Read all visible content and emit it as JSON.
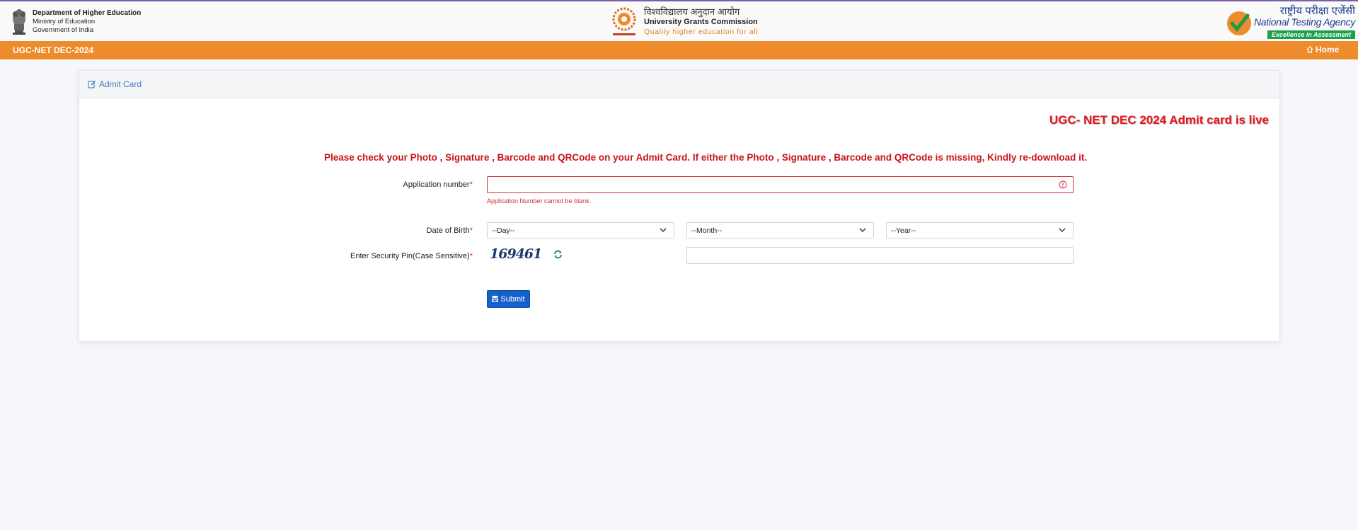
{
  "header": {
    "doe": {
      "line1": "Department of Higher Education",
      "line2": "Ministry of Education",
      "line3": "Government of India",
      "emblem_icon": "national-emblem-icon"
    },
    "ugc": {
      "hindi": "विश्वविद्यालय अनुदान आयोग",
      "english": "University Grants Commission",
      "tagline": "Quality higher education for all",
      "logo_icon": "ugc-logo-icon"
    },
    "nta": {
      "hindi": "राष्ट्रीय परीक्षा एजेंसी",
      "english": "National Testing Agency",
      "tagline": "Excellence in Assessment",
      "logo_icon": "nta-check-icon"
    }
  },
  "navbar": {
    "title": "UGC-NET DEC-2024",
    "home_label": "Home",
    "home_icon": "home-icon",
    "color": "#ee8b2d"
  },
  "card": {
    "title": "Admit Card",
    "title_icon": "edit-icon",
    "live_banner": "UGC- NET DEC 2024 Admit card is live",
    "notice": "Please check your Photo , Signature , Barcode and QRCode on your Admit Card. If either the Photo , Signature , Barcode and QRCode is missing, Kindly re-download it."
  },
  "form": {
    "application_number": {
      "label": "Application number",
      "required_mark": "*",
      "value": "",
      "error": "Application Number cannot be blank."
    },
    "dob": {
      "label": "Date of Birth",
      "required_mark": "*",
      "day_selected": "--Day--",
      "month_selected": "--Month--",
      "year_selected": "--Year--"
    },
    "security_pin": {
      "label": "Enter Security Pin(Case Sensitive)",
      "required_mark": "*",
      "captcha_text": "169461",
      "refresh_icon": "refresh-icon",
      "value": ""
    },
    "submit_label": "Submit",
    "submit_icon": "save-icon"
  },
  "colors": {
    "accent_orange": "#ee8b2d",
    "error_red": "#d2353d",
    "primary_blue": "#1660cb",
    "live_red": "#e8141b"
  }
}
